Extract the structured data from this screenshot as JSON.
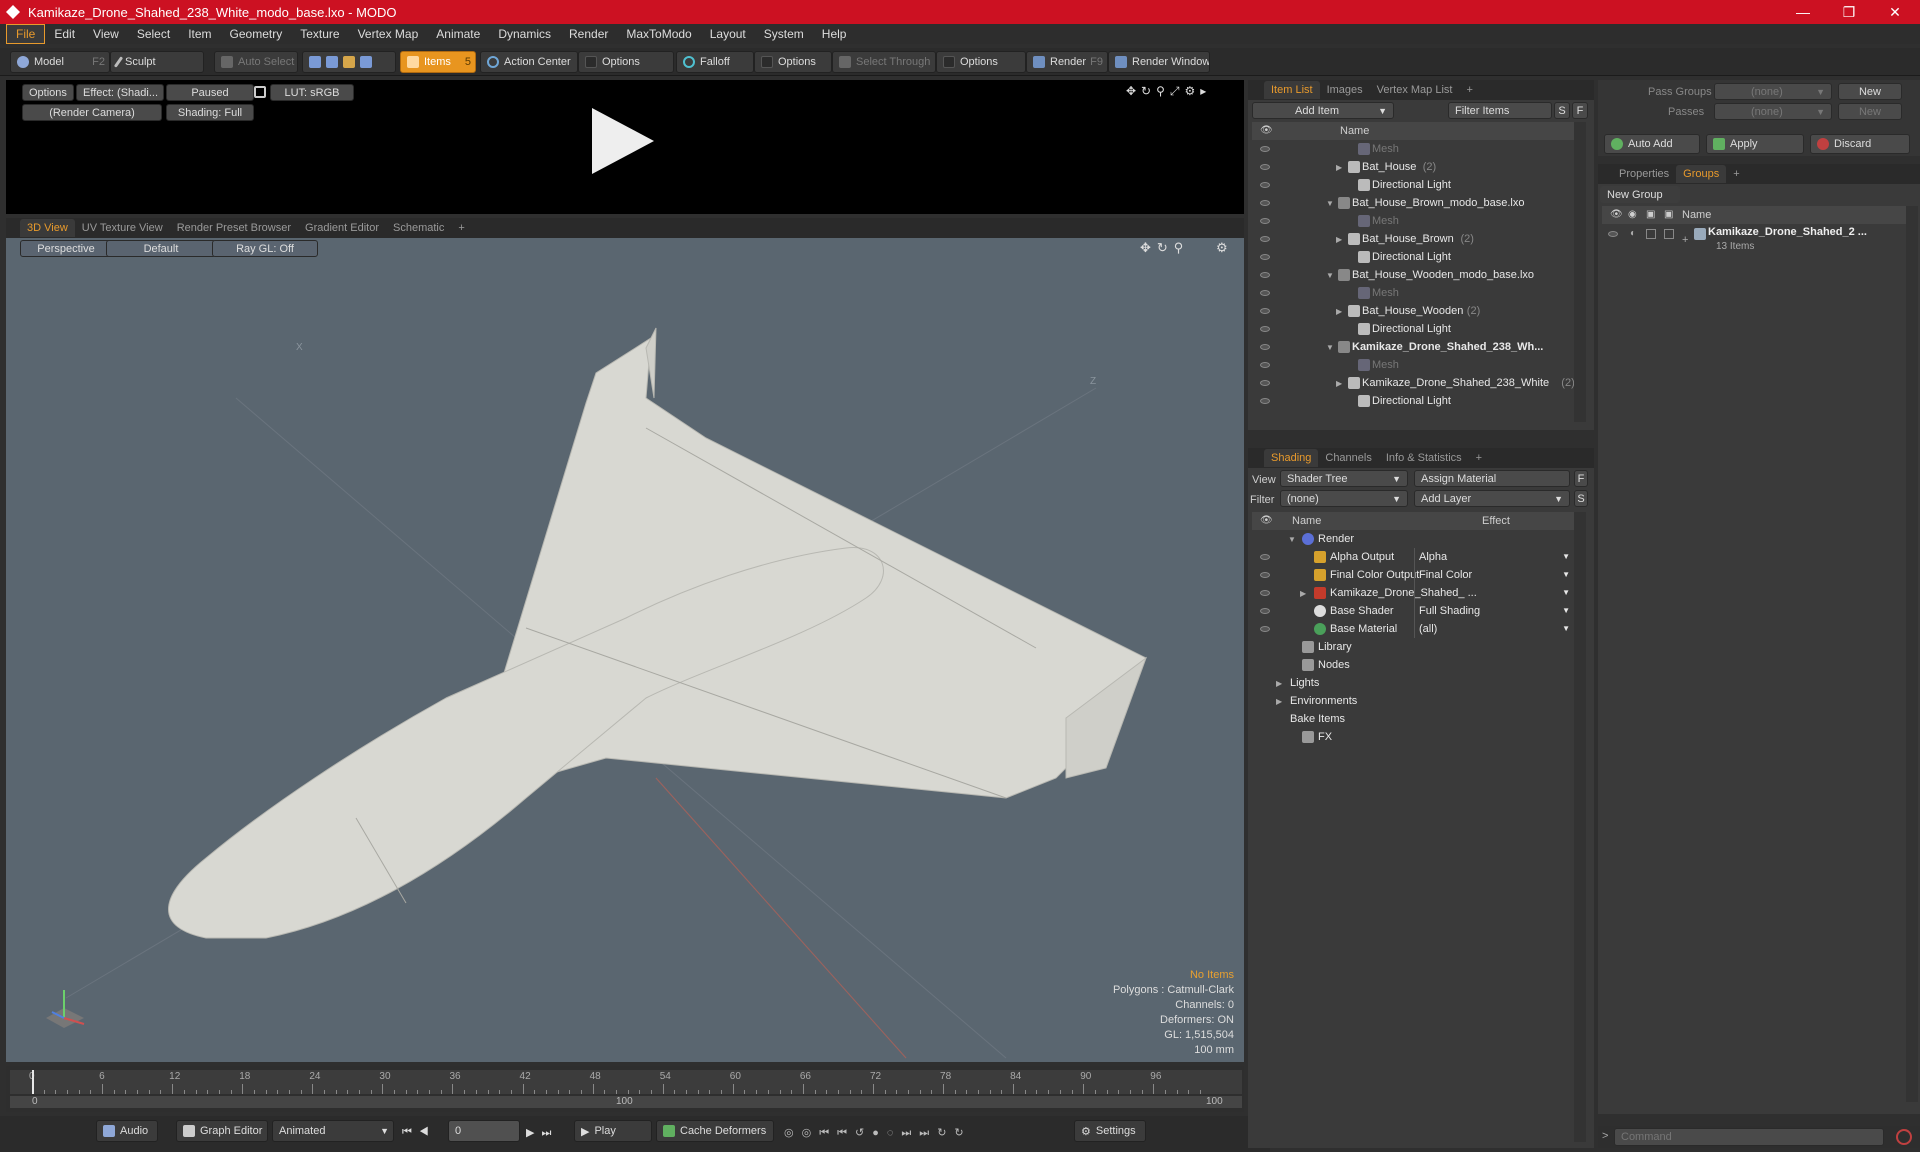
{
  "window": {
    "title": "Kamikaze_Drone_Shahed_238_White_modo_base.lxo - MODO",
    "minimize": "—",
    "maximize": "❐",
    "close": "✕"
  },
  "menu": [
    "File",
    "Edit",
    "View",
    "Select",
    "Item",
    "Geometry",
    "Texture",
    "Vertex Map",
    "Animate",
    "Dynamics",
    "Render",
    "MaxToModo",
    "Layout",
    "System",
    "Help"
  ],
  "toolbar": {
    "model": "Model",
    "model_key": "F2",
    "sculpt": "Sculpt",
    "auto_select": "Auto Select",
    "items": "Items",
    "items_key": "5",
    "action_center": "Action Center",
    "options1": "Options",
    "falloff": "Falloff",
    "options2": "Options",
    "select_through": "Select Through",
    "options3": "Options",
    "render": "Render",
    "render_key": "F9",
    "render_window": "Render Window"
  },
  "preview": {
    "options": "Options",
    "effect": "Effect: (Shadi...",
    "paused": "Paused",
    "lut": "LUT: sRGB",
    "camera": "(Render Camera)",
    "shading": "Shading: Full"
  },
  "viewport_tabs": [
    "3D View",
    "UV Texture View",
    "Render Preset Browser",
    "Gradient Editor",
    "Schematic",
    "+"
  ],
  "viewport": {
    "perspective": "Perspective",
    "default": "Default",
    "raygl": "Ray GL: Off",
    "axis_x": "X",
    "axis_z": "Z",
    "stats": [
      "No Items",
      "Polygons : Catmull-Clark",
      "Channels: 0",
      "Deformers: ON",
      "GL: 1,515,504",
      "100 mm"
    ]
  },
  "timeline": {
    "labels": [
      "0",
      "6",
      "12",
      "18",
      "24",
      "30",
      "36",
      "42",
      "48",
      "54",
      "60",
      "66",
      "72",
      "78",
      "84",
      "90",
      "96"
    ],
    "range_start": "0",
    "range_mid": "100",
    "range_end": "100"
  },
  "bottombar": {
    "audio": "Audio",
    "graph_editor": "Graph Editor",
    "animated": "Animated",
    "frame": "0",
    "play": "Play",
    "cache_deformers": "Cache Deformers",
    "settings": "Settings"
  },
  "itemlist": {
    "tabs": [
      "Item List",
      "Images",
      "Vertex Map List",
      "+"
    ],
    "add_item": "Add Item",
    "filter_items": "Filter Items",
    "s": "S",
    "f": "F",
    "name_col": "Name",
    "rows": [
      {
        "indent": 4,
        "arrow": "",
        "label": "Mesh",
        "count": "",
        "dim": true,
        "bold": false
      },
      {
        "indent": 3,
        "arrow": "▶",
        "label": "Bat_House",
        "count": "(2)",
        "dim": false,
        "bold": false
      },
      {
        "indent": 4,
        "arrow": "",
        "label": "Directional Light",
        "count": "",
        "dim": false,
        "bold": false
      },
      {
        "indent": 2,
        "arrow": "▼",
        "label": "Bat_House_Brown_modo_base.lxo",
        "count": "",
        "dim": false,
        "bold": false
      },
      {
        "indent": 4,
        "arrow": "",
        "label": "Mesh",
        "count": "",
        "dim": true,
        "bold": false
      },
      {
        "indent": 3,
        "arrow": "▶",
        "label": "Bat_House_Brown",
        "count": "(2)",
        "dim": false,
        "bold": false
      },
      {
        "indent": 4,
        "arrow": "",
        "label": "Directional Light",
        "count": "",
        "dim": false,
        "bold": false
      },
      {
        "indent": 2,
        "arrow": "▼",
        "label": "Bat_House_Wooden_modo_base.lxo",
        "count": "",
        "dim": false,
        "bold": false
      },
      {
        "indent": 4,
        "arrow": "",
        "label": "Mesh",
        "count": "",
        "dim": true,
        "bold": false
      },
      {
        "indent": 3,
        "arrow": "▶",
        "label": "Bat_House_Wooden",
        "count": "(2)",
        "dim": false,
        "bold": false
      },
      {
        "indent": 4,
        "arrow": "",
        "label": "Directional Light",
        "count": "",
        "dim": false,
        "bold": false
      },
      {
        "indent": 2,
        "arrow": "▼",
        "label": "Kamikaze_Drone_Shahed_238_Wh...",
        "count": "",
        "dim": false,
        "bold": true
      },
      {
        "indent": 4,
        "arrow": "",
        "label": "Mesh",
        "count": "",
        "dim": true,
        "bold": false
      },
      {
        "indent": 3,
        "arrow": "▶",
        "label": "Kamikaze_Drone_Shahed_238_White",
        "count": "(2)",
        "dim": false,
        "bold": false
      },
      {
        "indent": 4,
        "arrow": "",
        "label": "Directional Light",
        "count": "",
        "dim": false,
        "bold": false
      }
    ]
  },
  "shading": {
    "tabs": [
      "Shading",
      "Channels",
      "Info & Statistics",
      "+"
    ],
    "view_label": "View",
    "view_value": "Shader Tree",
    "assign_material": "Assign Material",
    "filter_label": "Filter",
    "filter_value": "(none)",
    "add_layer": "Add Layer",
    "f": "F",
    "s": "S",
    "name_col": "Name",
    "effect_col": "Effect",
    "rows": [
      {
        "indent": 0,
        "arrow": "▼",
        "label": "Render",
        "effect": "",
        "dd": false,
        "eye": false,
        "icon": "#5b6fd6"
      },
      {
        "indent": 1,
        "arrow": "",
        "label": "Alpha Output",
        "effect": "Alpha",
        "dd": true,
        "eye": true,
        "icon": "#d6a12c"
      },
      {
        "indent": 1,
        "arrow": "",
        "label": "Final Color Output",
        "effect": "Final Color",
        "dd": true,
        "eye": true,
        "icon": "#d6a12c"
      },
      {
        "indent": 1,
        "arrow": "▶",
        "label": "Kamikaze_Drone_Shahed_ ...",
        "effect": "",
        "dd": true,
        "eye": true,
        "icon": "#c43b2b"
      },
      {
        "indent": 1,
        "arrow": "",
        "label": "Base Shader",
        "effect": "Full Shading",
        "dd": true,
        "eye": true,
        "icon": "#dddddd"
      },
      {
        "indent": 1,
        "arrow": "",
        "label": "Base Material",
        "effect": "(all)",
        "dd": true,
        "eye": true,
        "icon": "#4aa05a"
      },
      {
        "indent": 0,
        "arrow": "",
        "label": "Library",
        "effect": "",
        "dd": false,
        "eye": false,
        "icon": "#999999"
      },
      {
        "indent": 0,
        "arrow": "",
        "label": "Nodes",
        "effect": "",
        "dd": false,
        "eye": false,
        "icon": "#999999"
      },
      {
        "indent": -1,
        "arrow": "▶",
        "label": "Lights",
        "effect": "",
        "dd": false,
        "eye": false,
        "icon": ""
      },
      {
        "indent": -1,
        "arrow": "▶",
        "label": "Environments",
        "effect": "",
        "dd": false,
        "eye": false,
        "icon": ""
      },
      {
        "indent": -1,
        "arrow": "",
        "label": "Bake Items",
        "effect": "",
        "dd": false,
        "eye": false,
        "icon": ""
      },
      {
        "indent": 0,
        "arrow": "",
        "label": "FX",
        "effect": "",
        "dd": false,
        "eye": false,
        "icon": "#999999"
      }
    ]
  },
  "passes": {
    "pass_groups": "Pass Groups",
    "passes": "Passes",
    "none1": "(none)",
    "none2": "(none)",
    "new1": "New",
    "new2": "New",
    "auto_add": "Auto Add",
    "apply": "Apply",
    "discard": "Discard"
  },
  "groups": {
    "tabs": [
      "Properties",
      "Groups",
      "+"
    ],
    "new_group": "New Group",
    "name_col": "Name",
    "group_name": "Kamikaze_Drone_Shahed_2 ...",
    "group_items": "13 Items"
  },
  "command": {
    "placeholder": "Command"
  },
  "colors": {
    "accent": "#e89a2c",
    "title": "#cc1122",
    "viewport": "#5a6670"
  }
}
